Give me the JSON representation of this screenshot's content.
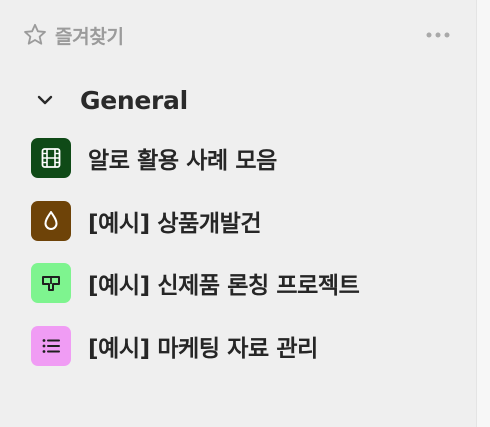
{
  "favorites": {
    "title": "즐겨찾기",
    "icon": "star-outline-icon",
    "more_icon": "more-horizontal-icon"
  },
  "group": {
    "label": "General",
    "icon": "chevron-down-icon"
  },
  "pages": [
    {
      "label": "알로 활용 사례 모음",
      "icon": "film-icon",
      "color": "#0f4a17"
    },
    {
      "label": "[예시] 상품개발건",
      "icon": "drop-icon",
      "color": "#6e4308"
    },
    {
      "label": "[예시] 신제품 론칭 프로젝트",
      "icon": "signboard-icon",
      "color": "#7ef48f"
    },
    {
      "label": "[예시] 마케팅 자료 관리",
      "icon": "list-icon",
      "color": "#f09cf4"
    }
  ]
}
